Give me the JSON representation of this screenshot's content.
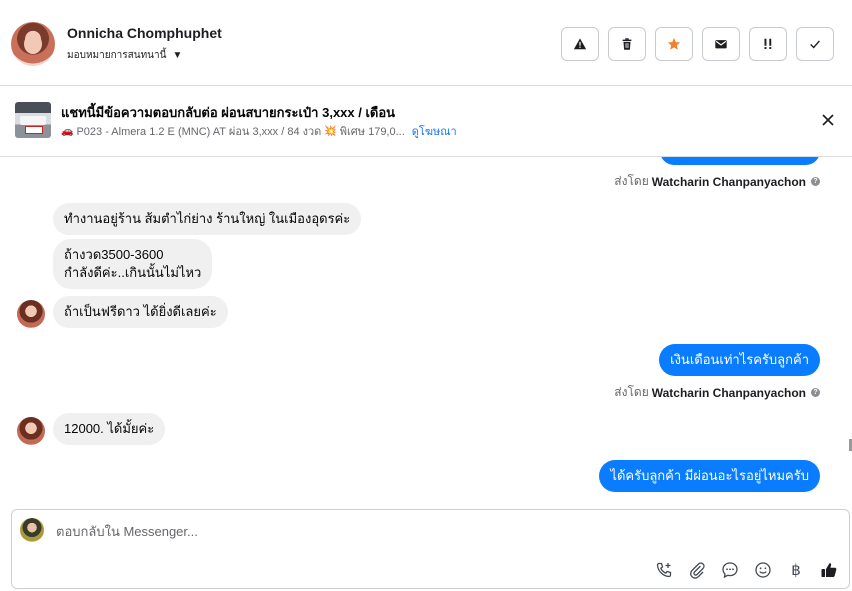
{
  "header": {
    "user_name": "Onnicha Chomphuphet",
    "assign_label": "มอบหมายการสนทนานี้",
    "actions": [
      {
        "icon": "alert-triangle-icon",
        "name": "spam-button"
      },
      {
        "icon": "trash-icon",
        "name": "delete-button"
      },
      {
        "icon": "star-icon",
        "name": "star-button",
        "color": "#f0822f"
      },
      {
        "icon": "envelope-icon",
        "name": "mark-unread-button"
      },
      {
        "icon": "double-exclamation-icon",
        "name": "follow-up-button"
      },
      {
        "icon": "checkmark-icon",
        "name": "done-button"
      }
    ]
  },
  "ad": {
    "title": "แชทนี้มีข้อความตอบกลับต่อ ผ่อนสบายกระเป๋า 3,xxx / เดือน",
    "subtitle_a": "P023 - Almera 1.2 E (MNC) AT ผ่อน 3,xxx / 84 งวด",
    "subtitle_b": "พิเศษ 179,0...",
    "link": "ดูโฆษณา"
  },
  "chat": {
    "messages": [
      {
        "id": "m1",
        "dir": "in",
        "text": "ทำงานอยู่ร้าน ส้มตำไก่ย่าง ร้านใหญ่ ในเมืองอุดรค่ะ"
      },
      {
        "id": "m2",
        "dir": "in",
        "line1": "ถ้างวด3500-3600",
        "line2": "กำลังดีค่ะ..เกินนั้นไม่ไหว"
      },
      {
        "id": "m3",
        "dir": "in",
        "text": "ถ้าเป็นฟรีดาว ได้ยิ่งดีเลยค่ะ"
      },
      {
        "id": "m4",
        "dir": "out",
        "text": "เงินเดือนเท่าไรครับลูกค้า"
      },
      {
        "id": "m5",
        "dir": "in",
        "text": "12000. ได้มั้ยค่ะ"
      },
      {
        "id": "m6",
        "dir": "out",
        "text": "ได้ครับลูกค้า มีผ่อนอะไรอยู่ไหมครับ"
      }
    ],
    "sent_by_label": "ส่งโดย",
    "sent_by_name": "Watcharin Chanpanyachon"
  },
  "composer": {
    "placeholder": "ตอบกลับใน Messenger...",
    "tools": [
      "phone-plus-icon",
      "paperclip-icon",
      "speech-bubble-icon",
      "smiley-icon",
      "baht-icon",
      "thumbs-up-icon"
    ],
    "baht_symbol": "฿"
  }
}
